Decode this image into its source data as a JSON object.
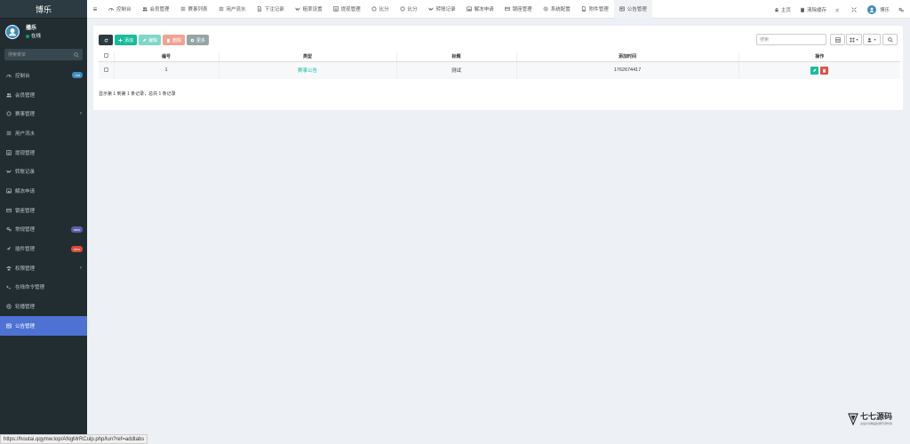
{
  "sidebar": {
    "logo": "博乐",
    "user": {
      "name": "播乐",
      "status": "在线"
    },
    "search_placeholder": "搜索菜单",
    "items": [
      {
        "label": "控制台",
        "icon": "dashboard-icon",
        "badge": "hot",
        "badge_color": "blue"
      },
      {
        "label": "会员管理",
        "icon": "users-icon"
      },
      {
        "label": "赛事管理",
        "icon": "circle-icon",
        "chevron": "‹"
      },
      {
        "label": "用户流水",
        "icon": "list-icon"
      },
      {
        "label": "提现管理",
        "icon": "list-alt-icon"
      },
      {
        "label": "转账记录",
        "icon": "vk-icon"
      },
      {
        "label": "解冻申请",
        "icon": "image-icon"
      },
      {
        "label": "银座管理",
        "icon": "card-icon"
      },
      {
        "label": "常规管理",
        "icon": "cogs-icon",
        "badge": "new",
        "badge_color": "purple"
      },
      {
        "label": "插件管理",
        "icon": "rocket-icon",
        "badge": "new",
        "badge_color": "red"
      },
      {
        "label": "权限管理",
        "icon": "group-icon",
        "chevron": "‹"
      },
      {
        "label": "在线命令管理",
        "icon": "terminal-icon"
      },
      {
        "label": "轮播管理",
        "icon": "dribbble-icon"
      },
      {
        "label": "公告管理",
        "icon": "newspaper-icon",
        "active": true
      }
    ]
  },
  "topnav": {
    "tabs": [
      {
        "label": "控制台",
        "icon": "dashboard-icon"
      },
      {
        "label": "会员管理",
        "icon": "users-icon"
      },
      {
        "label": "赛事列表",
        "icon": "list-icon"
      },
      {
        "label": "用户流水",
        "icon": "list-icon"
      },
      {
        "label": "下注记录",
        "icon": "file-icon"
      },
      {
        "label": "赔率设置",
        "icon": "vk-icon"
      },
      {
        "label": "提现管理",
        "icon": "list-alt-icon"
      },
      {
        "label": "比分",
        "icon": "circle-icon"
      },
      {
        "label": "比分",
        "icon": "circle-icon"
      },
      {
        "label": "转账记录",
        "icon": "vk-icon"
      },
      {
        "label": "解冻申请",
        "icon": "image-icon"
      },
      {
        "label": "银座管理",
        "icon": "card-icon"
      },
      {
        "label": "系统配置",
        "icon": "cog-icon"
      },
      {
        "label": "附件管理",
        "icon": "file-image-icon"
      },
      {
        "label": "公告管理",
        "icon": "newspaper-icon",
        "active": true
      }
    ],
    "right": {
      "home": "主页",
      "clear_cache": "清除缓存",
      "username": "博乐"
    }
  },
  "toolbar": {
    "add": "添加",
    "edit": "编辑",
    "delete": "删除",
    "more": "更多",
    "search_placeholder": "搜索"
  },
  "table": {
    "columns": [
      "编号",
      "类型",
      "标题",
      "添加时间",
      "操作"
    ],
    "rows": [
      {
        "id": "1",
        "type": "赛事公告",
        "title": "测试",
        "time": "1762674417"
      }
    ],
    "pagination": "显示第 1 到第 1 条记录，总共 1 条记录"
  },
  "statusbar": {
    "url": "https://houtai.qqymw.top/ANgMrRCulp.php/lun?ref=addtabs"
  },
  "watermark": {
    "name": "七七源码",
    "sub": "全站分享精品优质开源代码"
  },
  "colors": {
    "sidebar_bg": "#222d32",
    "active_menu": "#4e72d4",
    "success": "#18bc9c",
    "danger": "#e74c3c",
    "dark": "#2c3b41"
  }
}
